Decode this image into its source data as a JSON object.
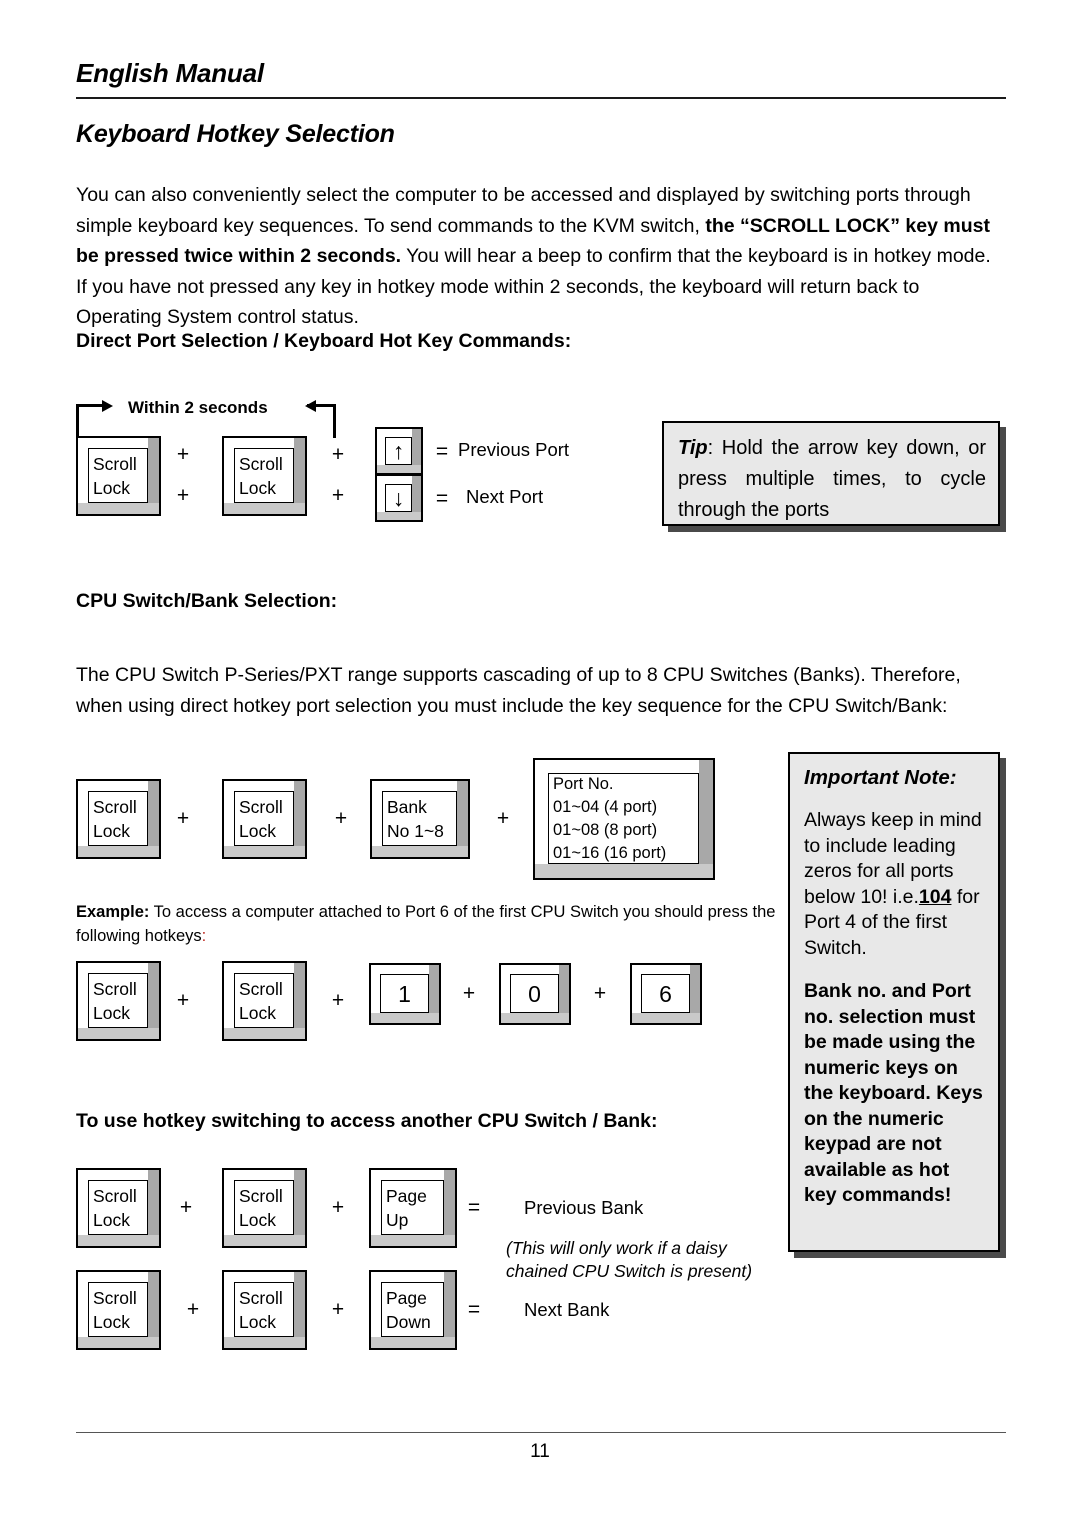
{
  "header": {
    "running_head": "English Manual",
    "doc_title": "Keyboard Hotkey Selection"
  },
  "intro": {
    "p1_a": "You can also conveniently select the computer to be accessed and displayed by switching ports through simple keyboard key sequences. To send commands to the KVM switch, ",
    "p1_b": "the “SCROLL LOCK” key must be pressed twice within 2 seconds.",
    "p1_c": " You will hear a beep to confirm that the keyboard is in hotkey mode. If you have not pressed any key in hotkey mode within 2 seconds, the keyboard will return back to Operating System control status."
  },
  "section1": {
    "heading": "Direct Port Selection / Keyboard Hot Key Commands:",
    "within_label": "Within 2 seconds",
    "keys": {
      "scroll": "Scroll",
      "lock": "Lock",
      "arrow_up": "↑",
      "arrow_down": "↓"
    },
    "op_plus": "+",
    "op_equals": "=",
    "result_prev": "Previous Port",
    "result_next": "Next Port"
  },
  "tip": {
    "label": "Tip",
    "colon": ":",
    "text": " Hold the arrow key down, or press multiple times, to cycle through the ports"
  },
  "section2": {
    "heading": "CPU Switch/Bank Selection:",
    "paragraph": "The CPU Switch P-Series/PXT range supports cascading of up to 8 CPU Switches (Banks). Therefore, when using direct hotkey port selection you must include the key sequence for the CPU Switch/Bank:",
    "keys": {
      "scroll": "Scroll",
      "lock": "Lock",
      "bank": "Bank",
      "bank_range": "No 1~8",
      "port_title": "Port No.",
      "port_l1": "01~04 (4 port)",
      "port_l2": "01~08 (8 port)",
      "port_l3": "01~16 (16 port)"
    },
    "op_plus": "+"
  },
  "example": {
    "label": "Example:",
    "text": " To access a computer attached to Port 6 of the first CPU Switch you should press the following hotkeys",
    "colon": ":",
    "keys": {
      "scroll": "Scroll",
      "lock": "Lock",
      "k1": "1",
      "k0": "0",
      "k6": "6"
    },
    "op_plus": "+"
  },
  "section3": {
    "heading": "To use hotkey switching to access another CPU Switch / Bank:",
    "keys": {
      "scroll": "Scroll",
      "lock": "Lock",
      "page": "Page",
      "up": "Up",
      "down": "Down"
    },
    "op_plus": "+",
    "op_equals": "=",
    "result_prev_bank": "Previous Bank",
    "result_next_bank": "Next Bank",
    "daisy_l1": "(This will only work if a daisy",
    "daisy_l2": "chained CPU Switch is present)"
  },
  "note": {
    "title": "Important Note:",
    "body_a": "Always keep in mind to include leading zeros for all ports below 10! i.e.",
    "body_104": "104",
    "body_b": " for Port 4 of the first Switch.",
    "body_bold": "Bank no. and Port no. selection must be made using the numeric keys on the keyboard. Keys on the numeric keypad are not available as hot key commands!"
  },
  "footer": {
    "page_number": "11"
  },
  "colors": {
    "key_face": "#ffffff",
    "key_shade_right": "#a8a8a8",
    "key_shade_bottom": "#c9c9c9",
    "callout_bg": "#e8e8e8",
    "callout_shadow": "#4a4a4a",
    "text": "#000000",
    "red_accent": "#c03028"
  }
}
